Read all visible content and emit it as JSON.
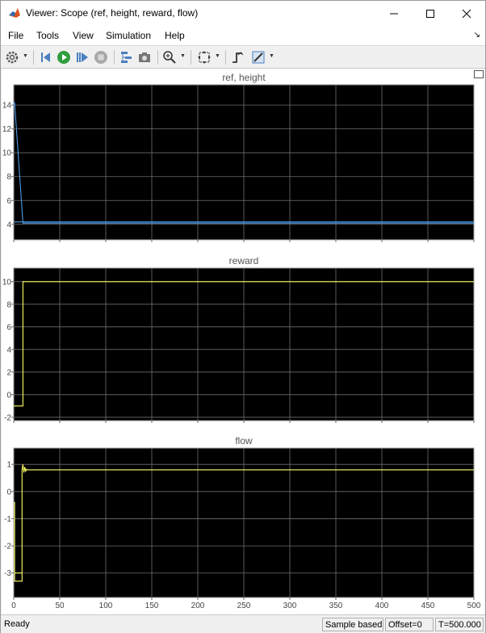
{
  "window": {
    "title": "Viewer: Scope (ref, height, reward, flow)"
  },
  "menu": {
    "items": [
      "File",
      "Tools",
      "View",
      "Simulation",
      "Help"
    ]
  },
  "toolbar": {
    "icons": [
      "gear-icon",
      "step-back-icon",
      "run-icon",
      "step-forward-icon",
      "stop-icon",
      "highlight-block-icon",
      "snapshot-icon",
      "zoom-icon",
      "autoscale-icon",
      "trigger-icon",
      "measure-icon"
    ]
  },
  "status": {
    "ready": "Ready",
    "sample_mode": "Sample based",
    "offset": "Offset=0",
    "time": "T=500.000"
  },
  "colors": {
    "plot_bg": "#000000",
    "grid": "#6e6e6e",
    "series_blue": "#4d9ae6",
    "series_yellow": "#ffff66"
  },
  "chart_data": [
    {
      "type": "line",
      "title": "ref, height",
      "xlim": [
        0,
        500
      ],
      "ylim": [
        2.7,
        15.7
      ],
      "yticks": [
        4,
        6,
        8,
        10,
        12,
        14
      ],
      "xticks": [
        0,
        50,
        100,
        150,
        200,
        250,
        300,
        350,
        400,
        450,
        500
      ],
      "grid": true,
      "series": [
        {
          "color": "#4d9ae6",
          "x": [
            0,
            0.5,
            1,
            10,
            500
          ],
          "y": [
            14,
            14.2,
            14.2,
            4.1,
            4.1
          ]
        },
        {
          "color": "#4d9ae6",
          "x": [
            0,
            500
          ],
          "y": [
            4.2,
            4.2
          ]
        }
      ]
    },
    {
      "type": "line",
      "title": "reward",
      "xlim": [
        0,
        500
      ],
      "ylim": [
        -2.3,
        11.2
      ],
      "yticks": [
        -2,
        0,
        2,
        4,
        6,
        8,
        10
      ],
      "xticks": [
        0,
        50,
        100,
        150,
        200,
        250,
        300,
        350,
        400,
        450,
        500
      ],
      "grid": true,
      "series": [
        {
          "color": "#ffff66",
          "x": [
            0,
            10,
            10,
            500
          ],
          "y": [
            -1,
            -1,
            10,
            10
          ]
        }
      ]
    },
    {
      "type": "line",
      "title": "flow",
      "xlim": [
        0,
        500
      ],
      "ylim": [
        -3.9,
        1.6
      ],
      "yticks": [
        -3,
        -2,
        -1,
        0,
        1
      ],
      "xticks": [
        0,
        50,
        100,
        150,
        200,
        250,
        300,
        350,
        400,
        450,
        500
      ],
      "grid": true,
      "series": [
        {
          "color": "#ffff66",
          "x": [
            0,
            1,
            1,
            9,
            9,
            10,
            11,
            12,
            13,
            14,
            15,
            500
          ],
          "y": [
            -0.4,
            -0.4,
            -3.3,
            -3.3,
            0.8,
            1.0,
            0.7,
            0.9,
            0.75,
            0.82,
            0.8,
            0.8
          ]
        },
        {
          "color": "#ffff66",
          "x": [
            1,
            9
          ],
          "y": [
            -3.0,
            -3.0
          ]
        }
      ]
    }
  ]
}
